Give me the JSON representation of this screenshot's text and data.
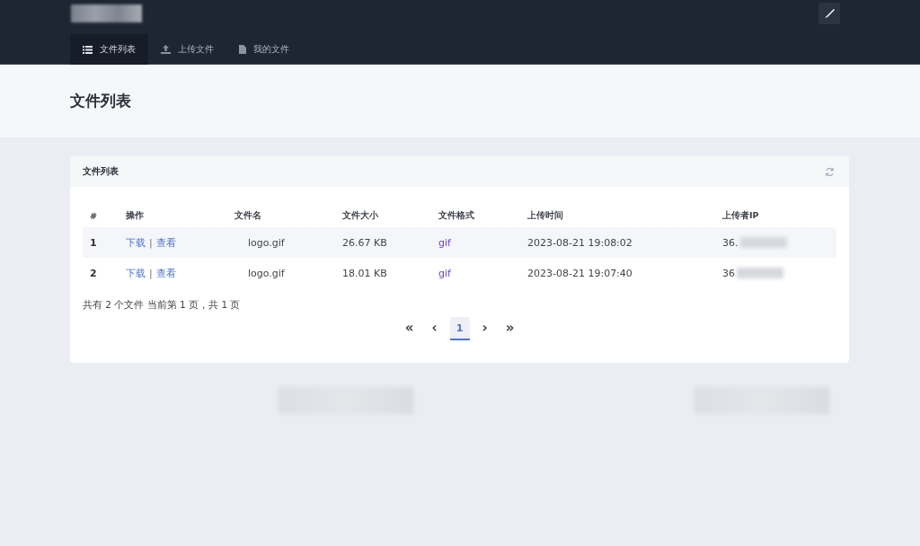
{
  "header": {
    "nav": [
      {
        "label": "文件列表",
        "selected": true
      },
      {
        "label": "上传文件",
        "selected": false
      },
      {
        "label": "我的文件",
        "selected": false
      }
    ]
  },
  "page_title": "文件列表",
  "card": {
    "title": "文件列表",
    "table": {
      "columns": [
        "#",
        "操作",
        "文件名",
        "文件大小",
        "文件格式",
        "上传时间",
        "上传者IP"
      ],
      "rows": [
        {
          "index": "1",
          "actions": [
            "下载",
            "查看"
          ],
          "separator": "|",
          "name": "logo.gif",
          "size": "26.67 KB",
          "format": "gif",
          "time": "2023-08-21 19:08:02",
          "ip": "36."
        },
        {
          "index": "2",
          "actions": [
            "下载",
            "查看"
          ],
          "separator": "|",
          "name": "logo.gif",
          "size": "18.01 KB",
          "format": "gif",
          "time": "2023-08-21 19:07:40",
          "ip": "36"
        }
      ]
    },
    "summary": "共有 2 个文件  当前第 1 页，共 1 页",
    "pagination": [
      {
        "label": "«",
        "selected": false
      },
      {
        "label": "‹",
        "selected": false
      },
      {
        "label": "1",
        "selected": true
      },
      {
        "label": "›",
        "selected": false
      },
      {
        "label": "»",
        "selected": false
      }
    ]
  }
}
